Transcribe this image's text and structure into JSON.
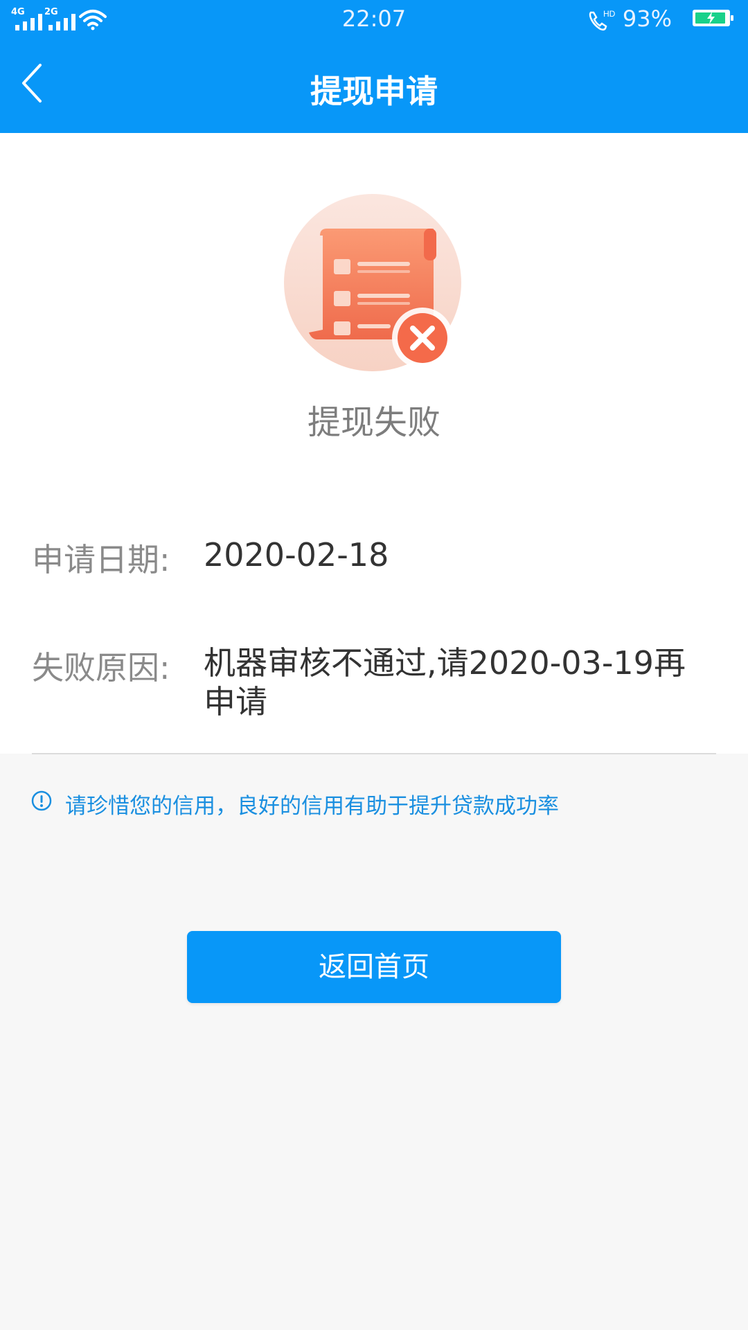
{
  "status_bar": {
    "network_1": "4G",
    "network_2": "2G",
    "time": "22:07",
    "call_badge": "HD",
    "battery_percent": "93%",
    "battery_level": 0.93
  },
  "header": {
    "title": "提现申请",
    "back_icon": "chevron-left-icon"
  },
  "result": {
    "icon": "document-failed-icon",
    "status_text": "提现失败"
  },
  "details": [
    {
      "label": "申请日期:",
      "value": "2020-02-18"
    },
    {
      "label": "失败原因:",
      "value_line1": "机器审核不通过,请2020-03-19再",
      "value_line2": "申请"
    }
  ],
  "notice": {
    "icon": "info-icon",
    "text": "请珍惜您的信用，良好的信用有助于提升贷款成功率"
  },
  "actions": {
    "home_button": "返回首页"
  },
  "colors": {
    "primary": "#0897f8",
    "notice": "#1a8fe0",
    "failure_orange": "#f47b58"
  }
}
